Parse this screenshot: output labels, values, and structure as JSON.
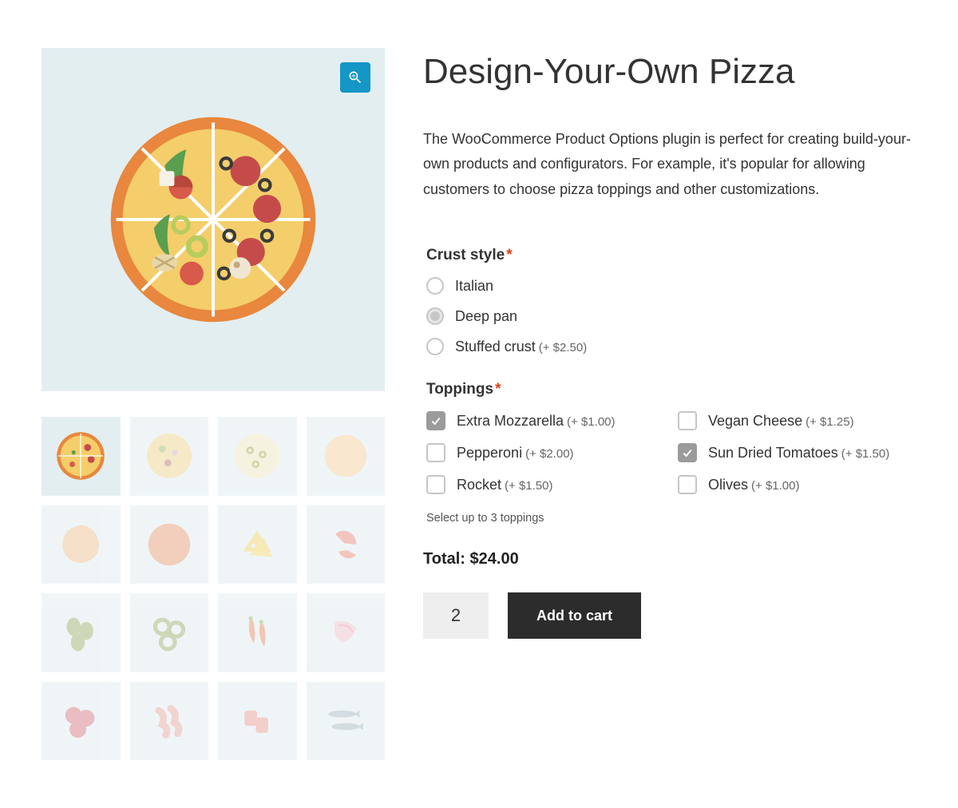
{
  "product": {
    "title": "Design-Your-Own Pizza",
    "description": "The WooCommerce Product Options plugin is perfect for creating build-your-own products and configurators. For example, it's popular for allowing customers to choose pizza toppings and other customizations."
  },
  "options": {
    "crust": {
      "label": "Crust style",
      "required": true,
      "items": [
        {
          "label": "Italian",
          "price": "",
          "selected": false
        },
        {
          "label": "Deep pan",
          "price": "",
          "selected": true
        },
        {
          "label": "Stuffed crust",
          "price": "(+ $2.50)",
          "selected": false
        }
      ]
    },
    "toppings": {
      "label": "Toppings",
      "required": true,
      "help": "Select up to 3 toppings",
      "items": [
        {
          "label": "Extra Mozzarella",
          "price": "(+ $1.00)",
          "checked": true
        },
        {
          "label": "Vegan Cheese",
          "price": "(+ $1.25)",
          "checked": false
        },
        {
          "label": "Pepperoni",
          "price": "(+ $2.00)",
          "checked": false
        },
        {
          "label": "Sun Dried Tomatoes",
          "price": "(+ $1.50)",
          "checked": true
        },
        {
          "label": "Rocket",
          "price": "(+ $1.50)",
          "checked": false
        },
        {
          "label": "Olives",
          "price": "(+ $1.00)",
          "checked": false
        }
      ]
    }
  },
  "total": {
    "label": "Total:",
    "value": "$24.00"
  },
  "cart": {
    "quantity": "2",
    "button": "Add to cart"
  }
}
